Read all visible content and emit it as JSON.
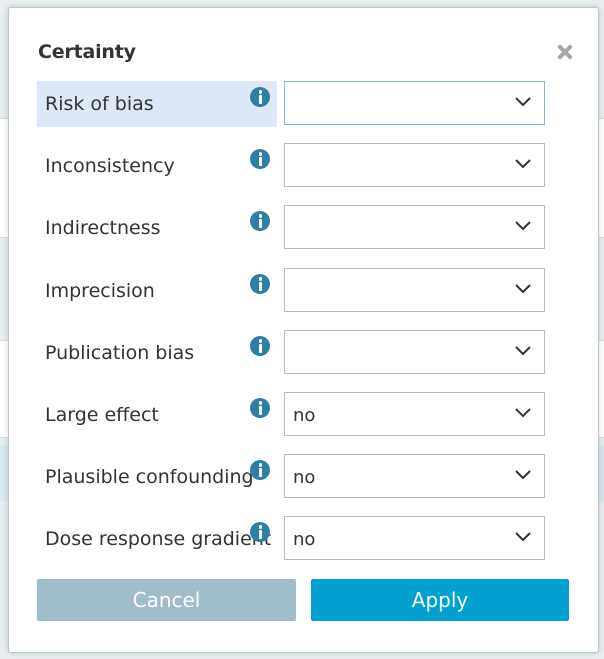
{
  "dialog": {
    "title": "Certainty"
  },
  "rows": [
    {
      "label": "Risk of bias",
      "value": ""
    },
    {
      "label": "Inconsistency",
      "value": ""
    },
    {
      "label": "Indirectness",
      "value": ""
    },
    {
      "label": "Imprecision",
      "value": ""
    },
    {
      "label": "Publication bias",
      "value": ""
    },
    {
      "label": "Large effect",
      "value": "no"
    },
    {
      "label": "Plausible confounding",
      "value": "no"
    },
    {
      "label": "Dose response gradient",
      "value": "no"
    }
  ],
  "buttons": {
    "cancel_label": "Cancel",
    "apply_label": "Apply"
  },
  "colors": {
    "accent": "#00a0d0",
    "cancel": "#a0bdc9",
    "info_icon": "#2f7fa5",
    "highlight": "#dde9f8"
  },
  "icons": {
    "close": "close-icon",
    "info": "info-icon",
    "dropdown": "chevron-down-icon"
  }
}
